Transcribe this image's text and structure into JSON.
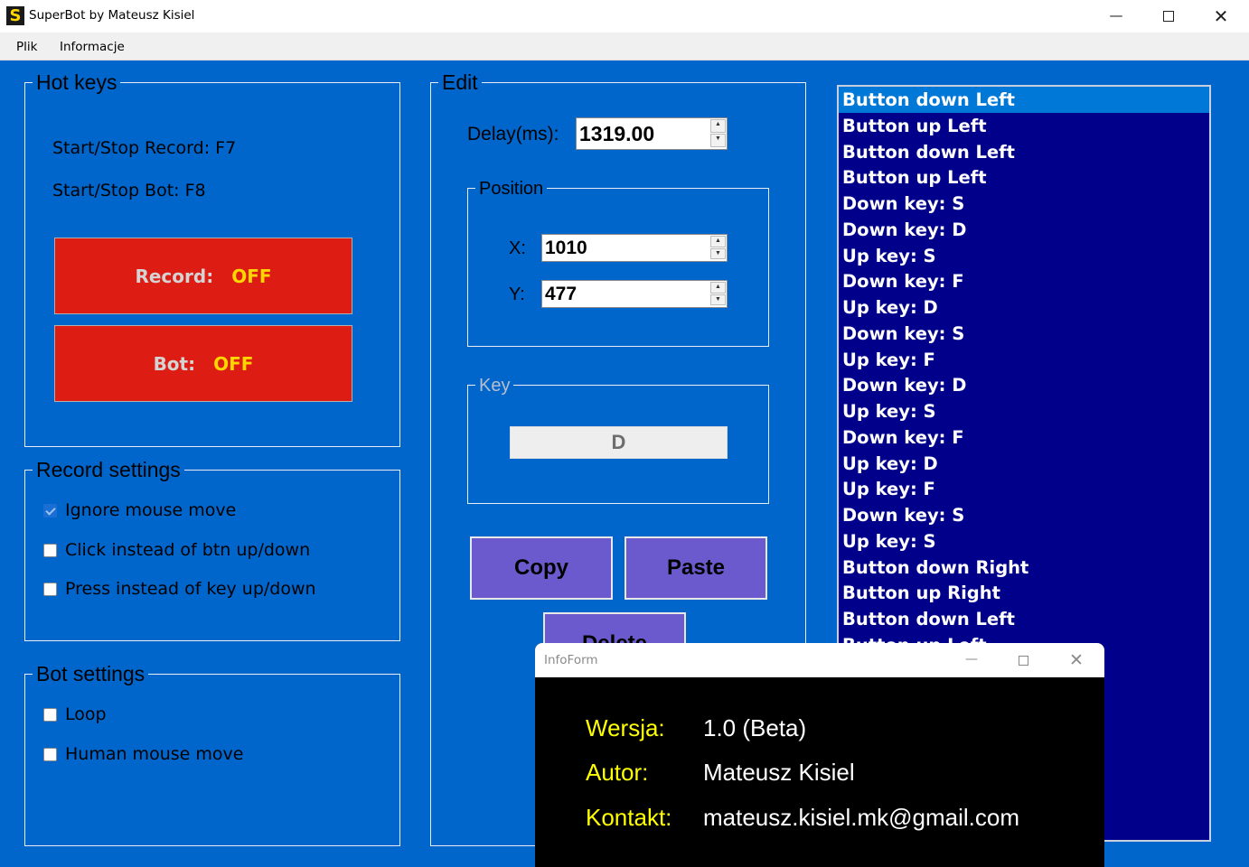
{
  "window": {
    "title": "SuperBot by Mateusz Kisiel",
    "icon_letter": "S",
    "controls": {
      "minimize": "—",
      "close": "✕"
    }
  },
  "menu": [
    "Plik",
    "Informacje"
  ],
  "hotkeys": {
    "title": "Hot keys",
    "record_hotkey": "Start/Stop Record: F7",
    "bot_hotkey": "Start/Stop Bot: F8",
    "record_button": {
      "label": "Record:",
      "state": "OFF"
    },
    "bot_button": {
      "label": "Bot:",
      "state": "OFF"
    }
  },
  "record_settings": {
    "title": "Record settings",
    "options": [
      {
        "label": "Ignore mouse move",
        "checked": true
      },
      {
        "label": "Click instead of btn up/down",
        "checked": false
      },
      {
        "label": "Press instead of key up/down",
        "checked": false
      }
    ]
  },
  "bot_settings": {
    "title": "Bot settings",
    "options": [
      {
        "label": "Loop",
        "checked": false
      },
      {
        "label": "Human mouse move",
        "checked": false
      }
    ]
  },
  "edit": {
    "title": "Edit",
    "delay_label": "Delay(ms):",
    "delay_value": "1319.00",
    "position": {
      "title": "Position",
      "x_label": "X:",
      "x_value": "1010",
      "y_label": "Y:",
      "y_value": "477"
    },
    "key": {
      "title": "Key",
      "value": "D"
    },
    "copy_button": "Copy",
    "paste_button": "Paste",
    "delete_button": "Delete",
    "spin_up": "▲",
    "spin_down": "▼"
  },
  "events": {
    "selected_index": 0,
    "items": [
      "Button down Left",
      "Button up Left",
      "Button down Left",
      "Button up Left",
      "Down key: S",
      "Down key: D",
      "Up key: S",
      "Down key: F",
      "Up key: D",
      "Down key: S",
      "Up key: F",
      "Down key: D",
      "Up key: S",
      "Down key: F",
      "Up key: D",
      "Up key: F",
      "Down key: S",
      "Up key: S",
      "Button down Right",
      "Button up Right",
      "Button down Left",
      "Button up Left"
    ]
  },
  "info_form": {
    "title": "InfoForm",
    "controls": {
      "minimize": "—",
      "close": "✕"
    },
    "version_label": "Wersja:",
    "version_value": "1.0 (Beta)",
    "author_label": "Autor:",
    "author_value": "Mateusz Kisiel",
    "contact_label": "Kontakt:",
    "contact_value": "mateusz.kisiel.mk@gmail.com"
  },
  "colors": {
    "background": "#0066cc",
    "button_off": "#dd1c14",
    "state_text": "#ffd700",
    "action_button": "#6a5acd",
    "list_background": "#00008b",
    "list_selected": "#0078d7",
    "info_label": "#ffff00"
  }
}
